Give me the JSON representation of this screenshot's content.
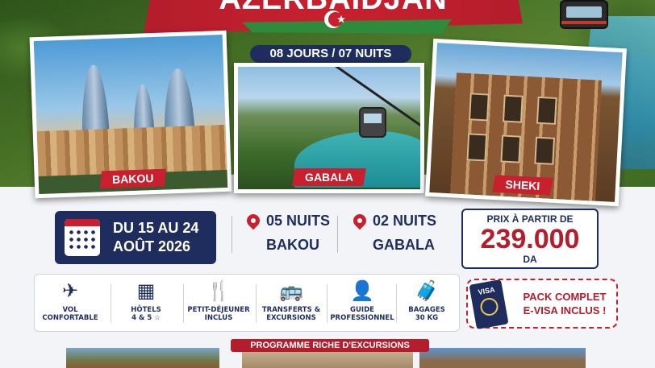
{
  "header": {
    "title": "AZERBAÏDJAN",
    "duration": "08 JOURS / 07 NUITS"
  },
  "cards": [
    {
      "label": "BAKOU"
    },
    {
      "label": "GABALA"
    },
    {
      "label": "SHEKI"
    }
  ],
  "dates": {
    "line1": "DU 15 AU 24",
    "line2": "AOÛT 2026"
  },
  "stays": [
    {
      "nights": "05 NUITS",
      "city": "BAKOU"
    },
    {
      "nights": "02 NUITS",
      "city": "GABALA"
    }
  ],
  "price": {
    "label": "PRIX À PARTIR DE",
    "value": "239.000",
    "currency": "DA"
  },
  "features": [
    {
      "icon": "plane-icon",
      "line1": "VOL",
      "line2": "CONFORTABLE"
    },
    {
      "icon": "hotel-icon",
      "line1": "HÔTELS",
      "line2": "4 & 5 ☆"
    },
    {
      "icon": "cutlery-icon",
      "line1": "PETIT-DÉJEUNER",
      "line2": "INCLUS"
    },
    {
      "icon": "bus-icon",
      "line1": "TRANSFERTS &",
      "line2": "EXCURSIONS"
    },
    {
      "icon": "guide-icon",
      "line1": "GUIDE",
      "line2": "PROFESSIONNEL"
    },
    {
      "icon": "luggage-icon",
      "line1": "BAGAGES",
      "line2": "30 KG"
    }
  ],
  "visa": {
    "passport_label": "VISA",
    "line1": "PACK COMPLET",
    "line2": "E-VISA INCLUS !"
  },
  "program": {
    "label": "PROGRAMME RICHE D'EXCURSIONS"
  },
  "colors": {
    "navy": "#1f2d5e",
    "red": "#b41d2c",
    "green": "#2f8a3b"
  }
}
